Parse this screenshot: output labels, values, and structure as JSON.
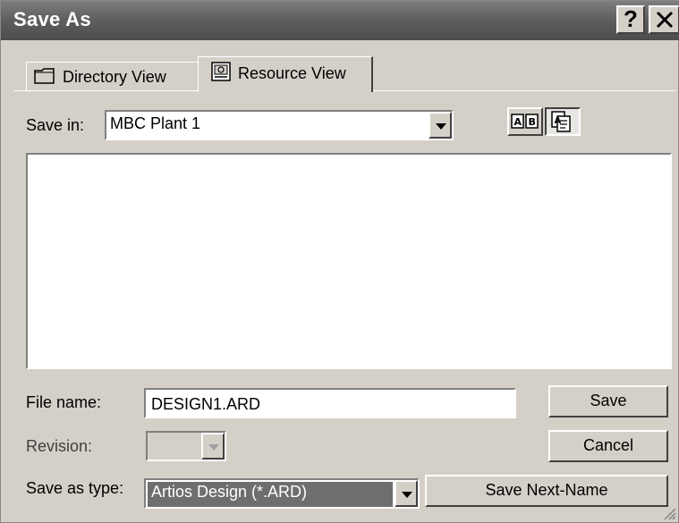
{
  "window": {
    "title": "Save As",
    "help_label": "?",
    "close_label": "✕"
  },
  "tabs": [
    {
      "label": "Directory View",
      "icon": "folder-icon",
      "active": false
    },
    {
      "label": "Resource View",
      "icon": "resource-icon",
      "active": true
    }
  ],
  "save_in": {
    "label": "Save in:",
    "value": "MBC Plant 1"
  },
  "view_buttons": [
    {
      "icon": "list-view-icon",
      "pressed": false
    },
    {
      "icon": "detail-view-icon",
      "pressed": true
    }
  ],
  "file_name": {
    "label": "File name:",
    "value": "DESIGN1.ARD"
  },
  "revision": {
    "label": "Revision:",
    "value": ""
  },
  "save_as_type": {
    "label": "Save as type:",
    "value": "Artios Design (*.ARD)"
  },
  "buttons": {
    "save": "Save",
    "cancel": "Cancel",
    "save_next_name": "Save Next-Name"
  },
  "colors": {
    "titlebar": "#606060",
    "dialog_bg": "#d4d0c8",
    "selection": "#6e6e6e"
  }
}
